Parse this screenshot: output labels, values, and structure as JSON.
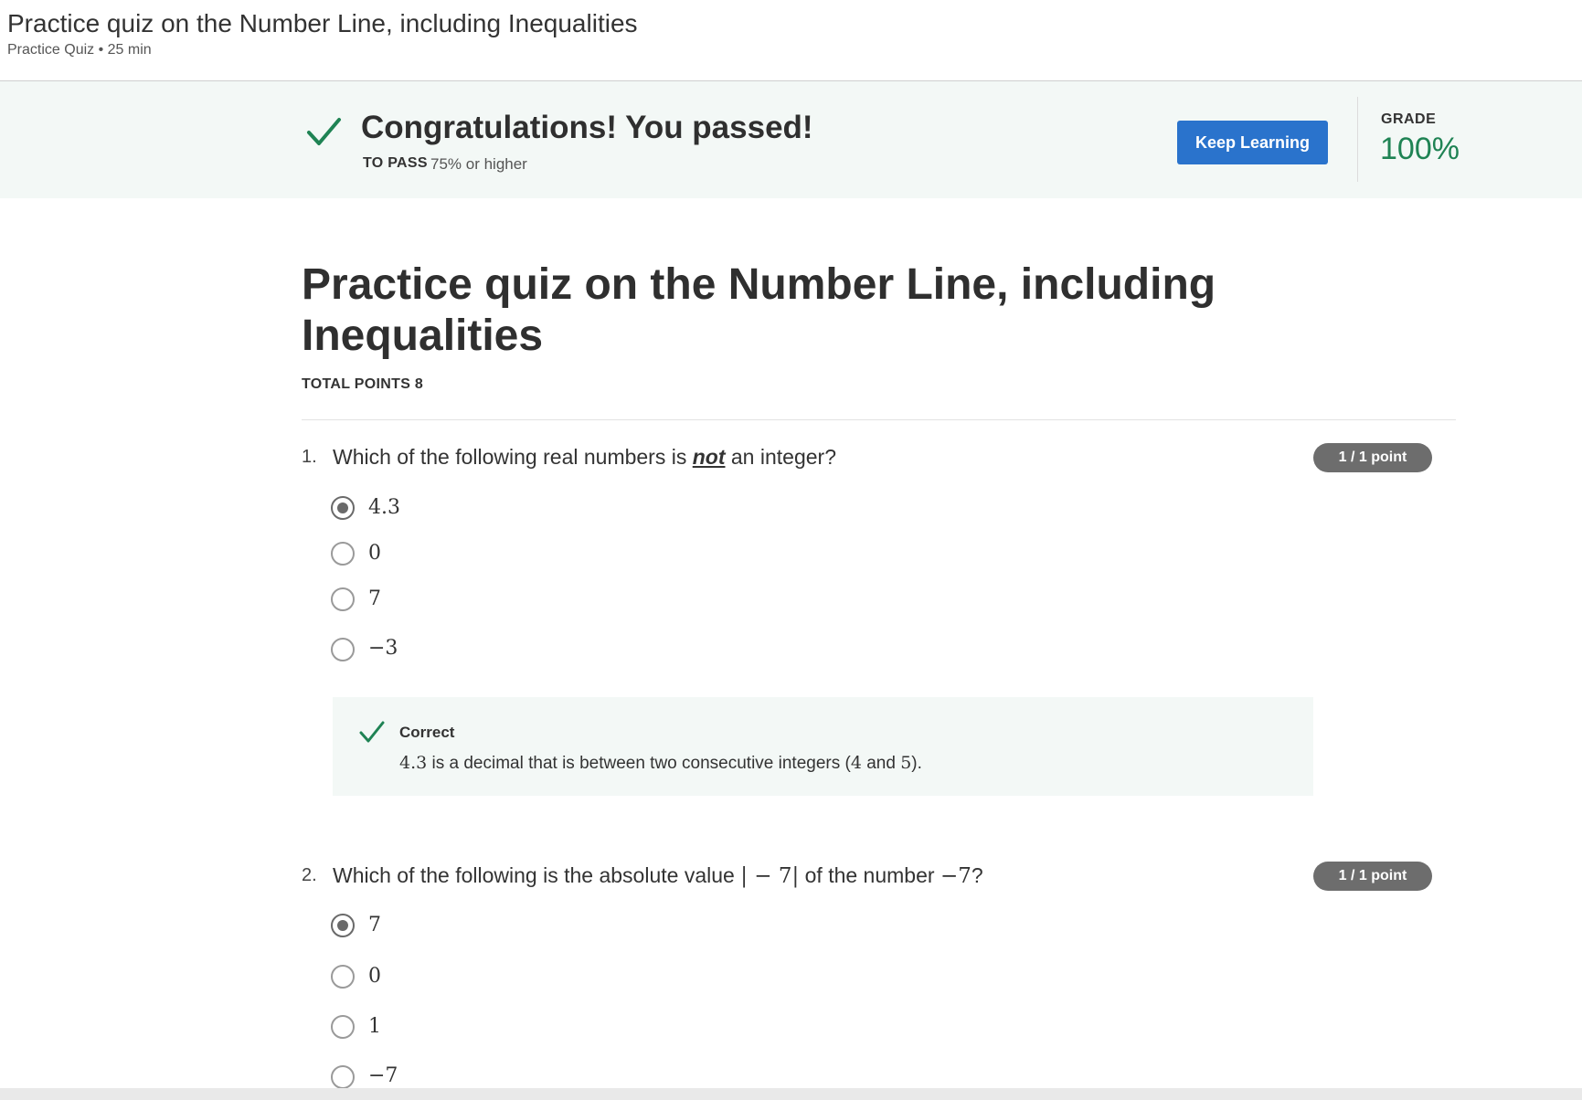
{
  "header": {
    "title": "Practice quiz on the Number Line, including Inequalities",
    "subtitle": "Practice Quiz • 25 min"
  },
  "banner": {
    "check_icon": "checkmark-icon",
    "headline": "Congratulations! You passed!",
    "to_pass_label": "TO PASS",
    "to_pass_value": "75% or higher",
    "keep_learning_label": "Keep Learning",
    "grade_label": "GRADE",
    "grade_value": "100%",
    "accent_color": "#1f8354",
    "button_color": "#2a73cc"
  },
  "quiz": {
    "title": "Practice quiz on the Number Line, including Inequalities",
    "total_points": "TOTAL POINTS 8",
    "questions": [
      {
        "number": "1.",
        "text_before": "Which of the following real numbers is ",
        "text_emph": "not",
        "text_after": " an integer?",
        "points": "1 / 1 point",
        "options": [
          {
            "label": "4.3",
            "selected": true
          },
          {
            "label": "0",
            "selected": false
          },
          {
            "label": "7",
            "selected": false
          },
          {
            "label": "−3",
            "selected": false
          }
        ],
        "feedback": {
          "title": "Correct",
          "math_value": "4.3",
          "text_1": " is a decimal that is between two consecutive integers (",
          "math_a": "4",
          "text_2": " and ",
          "math_b": "5",
          "text_3": ")."
        }
      },
      {
        "number": "2.",
        "text_before": "Which of the following is the absolute value ",
        "math_abs": "| − 7|",
        "text_mid": " of the number ",
        "math_num": "−7",
        "text_after": "?",
        "points": "1 / 1 point",
        "options": [
          {
            "label": "7",
            "selected": true
          },
          {
            "label": "0",
            "selected": false
          },
          {
            "label": "1",
            "selected": false
          },
          {
            "label": "−7",
            "selected": false
          }
        ]
      }
    ]
  }
}
